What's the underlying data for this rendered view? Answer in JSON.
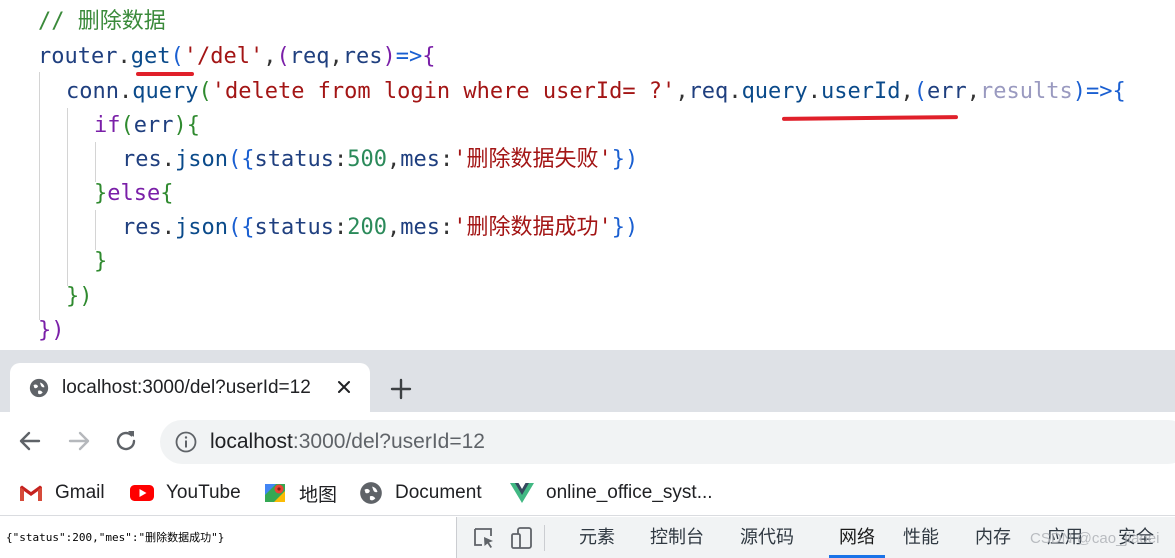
{
  "editor": {
    "lines": [
      {
        "tokens": [
          {
            "t": "// 删除数据",
            "c": "tok-comment"
          }
        ]
      },
      {
        "tokens": [
          {
            "t": "router",
            "c": "tok-ident"
          },
          {
            "t": ".",
            "c": "tok-punc"
          },
          {
            "t": "get",
            "c": "tok-prop"
          },
          {
            "t": "(",
            "c": "tok-brace1"
          },
          {
            "t": "'/del'",
            "c": "tok-str"
          },
          {
            "t": ",",
            "c": "tok-punc"
          },
          {
            "t": "(",
            "c": "tok-brace2"
          },
          {
            "t": "req",
            "c": "tok-ident"
          },
          {
            "t": ",",
            "c": "tok-punc"
          },
          {
            "t": "res",
            "c": "tok-ident"
          },
          {
            "t": ")",
            "c": "tok-brace2"
          },
          {
            "t": "=>",
            "c": "tok-brace1"
          },
          {
            "t": "{",
            "c": "tok-brace2"
          }
        ]
      },
      {
        "tokens": [
          {
            "t": "conn",
            "c": "tok-ident"
          },
          {
            "t": ".",
            "c": "tok-punc"
          },
          {
            "t": "query",
            "c": "tok-prop"
          },
          {
            "t": "(",
            "c": "tok-brace3"
          },
          {
            "t": "'delete from login where userId= ?'",
            "c": "tok-str"
          },
          {
            "t": ",",
            "c": "tok-punc"
          },
          {
            "t": "req",
            "c": "tok-ident"
          },
          {
            "t": ".",
            "c": "tok-punc"
          },
          {
            "t": "query",
            "c": "tok-prop"
          },
          {
            "t": ".",
            "c": "tok-punc"
          },
          {
            "t": "userId",
            "c": "tok-prop"
          },
          {
            "t": ",",
            "c": "tok-punc"
          },
          {
            "t": "(",
            "c": "tok-brace1"
          },
          {
            "t": "err",
            "c": "tok-ident"
          },
          {
            "t": ",",
            "c": "tok-punc"
          },
          {
            "t": "results",
            "c": "tok-dim"
          },
          {
            "t": ")",
            "c": "tok-brace1"
          },
          {
            "t": "=>",
            "c": "tok-brace1"
          },
          {
            "t": "{",
            "c": "tok-brace1"
          }
        ]
      },
      {
        "tokens": [
          {
            "t": "if",
            "c": "tok-kw"
          },
          {
            "t": "(",
            "c": "tok-brace3"
          },
          {
            "t": "err",
            "c": "tok-ident"
          },
          {
            "t": ")",
            "c": "tok-brace3"
          },
          {
            "t": "{",
            "c": "tok-brace3"
          }
        ]
      },
      {
        "tokens": [
          {
            "t": "res",
            "c": "tok-ident"
          },
          {
            "t": ".",
            "c": "tok-punc"
          },
          {
            "t": "json",
            "c": "tok-prop"
          },
          {
            "t": "(",
            "c": "tok-brace1"
          },
          {
            "t": "{",
            "c": "tok-brace1"
          },
          {
            "t": "status",
            "c": "tok-ident"
          },
          {
            "t": ":",
            "c": "tok-punc"
          },
          {
            "t": "500",
            "c": "tok-num"
          },
          {
            "t": ",",
            "c": "tok-punc"
          },
          {
            "t": "mes",
            "c": "tok-ident"
          },
          {
            "t": ":",
            "c": "tok-punc"
          },
          {
            "t": "'删除数据失败'",
            "c": "tok-str"
          },
          {
            "t": "}",
            "c": "tok-brace1"
          },
          {
            "t": ")",
            "c": "tok-brace1"
          }
        ]
      },
      {
        "tokens": [
          {
            "t": "}",
            "c": "tok-brace3"
          },
          {
            "t": "else",
            "c": "tok-kw"
          },
          {
            "t": "{",
            "c": "tok-brace3"
          }
        ]
      },
      {
        "tokens": [
          {
            "t": "res",
            "c": "tok-ident"
          },
          {
            "t": ".",
            "c": "tok-punc"
          },
          {
            "t": "json",
            "c": "tok-prop"
          },
          {
            "t": "(",
            "c": "tok-brace1"
          },
          {
            "t": "{",
            "c": "tok-brace1"
          },
          {
            "t": "status",
            "c": "tok-ident"
          },
          {
            "t": ":",
            "c": "tok-punc"
          },
          {
            "t": "200",
            "c": "tok-num"
          },
          {
            "t": ",",
            "c": "tok-punc"
          },
          {
            "t": "mes",
            "c": "tok-ident"
          },
          {
            "t": ":",
            "c": "tok-punc"
          },
          {
            "t": "'删除数据成功'",
            "c": "tok-str"
          },
          {
            "t": "}",
            "c": "tok-brace1"
          },
          {
            "t": ")",
            "c": "tok-brace1"
          }
        ]
      },
      {
        "tokens": [
          {
            "t": "}",
            "c": "tok-brace3"
          }
        ]
      },
      {
        "tokens": [
          {
            "t": "})",
            "c": "tok-brace3"
          }
        ]
      },
      {
        "tokens": [
          {
            "t": "})",
            "c": "tok-brace2"
          }
        ]
      }
    ]
  },
  "browser": {
    "tab": {
      "title": "localhost:3000/del?userId=12",
      "close_icon": "close-icon",
      "site_icon": "globe-icon"
    },
    "new_tab_icon": "plus-icon",
    "nav": {
      "back_icon": "arrow-left-icon",
      "forward_icon": "arrow-right-icon",
      "reload_icon": "reload-icon"
    },
    "omnibox": {
      "host": "localhost",
      "path": ":3000/del?userId=12",
      "info_icon": "info-icon"
    },
    "bookmarks": [
      {
        "label": "Gmail",
        "icon": "gmail-icon"
      },
      {
        "label": "YouTube",
        "icon": "youtube-icon"
      },
      {
        "label": "地图",
        "icon": "maps-icon"
      },
      {
        "label": "Document",
        "icon": "globe-icon"
      },
      {
        "label": "online_office_syst...",
        "icon": "vue-icon"
      }
    ]
  },
  "page": {
    "response_text": "{\"status\":200,\"mes\":\"删除数据成功\"}"
  },
  "devtools": {
    "tabs": [
      "元素",
      "控制台",
      "源代码",
      "网络",
      "性能",
      "内存",
      "应用",
      "安全"
    ],
    "active_tab": "网络",
    "accent_color": "#1a73e8"
  },
  "watermark": "CSDN @cao_jiaoei",
  "colors": {
    "squiggle": "#e0202a",
    "tabstrip_bg": "#dee1e6",
    "omnibox_bg": "#f1f3f4"
  }
}
